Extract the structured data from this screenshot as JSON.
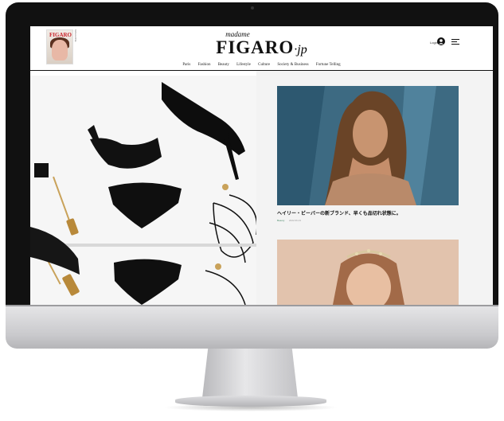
{
  "site": {
    "logo_madame": "madame",
    "logo_main": "FIGARO",
    "logo_suffix": "·jp",
    "login": "Login",
    "magazine_title": "FIGARO"
  },
  "nav": {
    "items": [
      "Paris",
      "Fashion",
      "Beauty",
      "Lifestyle",
      "Culture",
      "Society & Business",
      "Fortune Telling"
    ]
  },
  "articles": [
    {
      "caption": "ヘイリー・ビーバーの新ブランド、早くも品切れ状態に。",
      "category": "Beauty",
      "date": "2022.06.23"
    }
  ],
  "icons": {
    "user": "user-circle-icon",
    "menu": "hamburger-menu-icon"
  },
  "colors": {
    "background": "#ffffff",
    "bezel": "#111111",
    "text": "#111111",
    "sidebar": "#f3f3f3"
  }
}
